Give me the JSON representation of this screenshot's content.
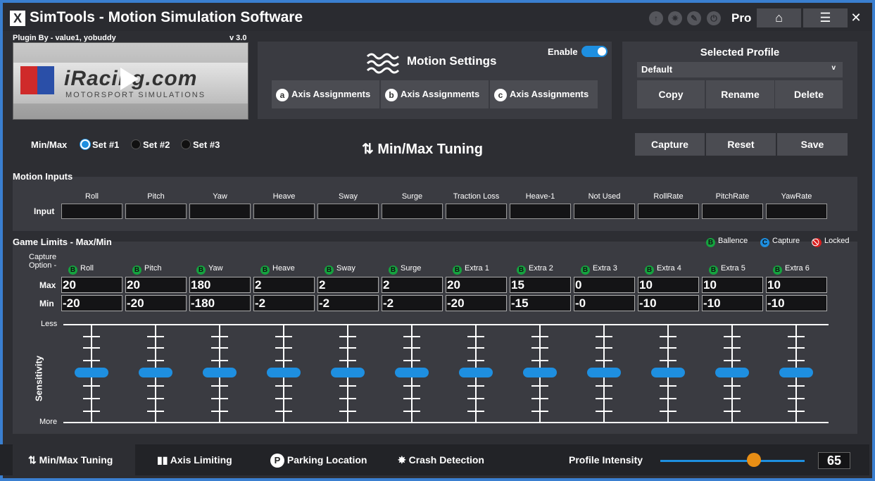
{
  "app": {
    "logo": "X",
    "title": "SimTools - Motion Simulation Software",
    "tier": "Pro"
  },
  "titlebar_icons": [
    "arrow-up-icon",
    "sparkle-icon",
    "wrench-icon",
    "power-icon"
  ],
  "plugin": {
    "by": "Plugin By - value1, yobuddy",
    "version": "v 3.0",
    "game_name": "iRacing.com",
    "game_sub": "MOTORSPORT SIMULATIONS"
  },
  "motion_settings": {
    "title": "Motion Settings",
    "enable_label": "Enable",
    "enabled": true,
    "axis_buttons": [
      {
        "letter": "a",
        "label": "Axis Assignments"
      },
      {
        "letter": "b",
        "label": "Axis Assignments"
      },
      {
        "letter": "c",
        "label": "Axis Assignments"
      }
    ]
  },
  "profile": {
    "title": "Selected Profile",
    "selected": "Default",
    "chevron": "v",
    "buttons": [
      "Copy",
      "Rename",
      "Delete"
    ]
  },
  "tuning": {
    "minmax_label": "Min/Max",
    "sets": [
      "Set #1",
      "Set #2",
      "Set #3"
    ],
    "selected_set": 0,
    "title": "Min/Max Tuning",
    "buttons": [
      "Capture",
      "Reset",
      "Save"
    ]
  },
  "motion_inputs": {
    "title": "Motion Inputs",
    "row_label": "Input",
    "columns": [
      "Roll",
      "Pitch",
      "Yaw",
      "Heave",
      "Sway",
      "Surge",
      "Traction Loss",
      "Heave-1",
      "Not Used",
      "RollRate",
      "PitchRate",
      "YawRate"
    ]
  },
  "game_limits": {
    "title": "Game Limits - Max/Min",
    "legend": [
      {
        "letter": "B",
        "label": "Ballence",
        "color": "#15a33f"
      },
      {
        "letter": "C",
        "label": "Capture",
        "color": "#1e8fe0"
      },
      {
        "letter": "",
        "label": "Locked",
        "color": "#d81f1f"
      }
    ],
    "capture_option_label": "Capture Option -",
    "max_label": "Max",
    "min_label": "Min",
    "axes": [
      {
        "name": "Roll",
        "max": "20",
        "min": "-20"
      },
      {
        "name": "Pitch",
        "max": "20",
        "min": "-20"
      },
      {
        "name": "Yaw",
        "max": "180",
        "min": "-180"
      },
      {
        "name": "Heave",
        "max": "2",
        "min": "-2"
      },
      {
        "name": "Sway",
        "max": "2",
        "min": "-2"
      },
      {
        "name": "Surge",
        "max": "2",
        "min": "-2"
      },
      {
        "name": "Extra 1",
        "max": "20",
        "min": "-20"
      },
      {
        "name": "Extra 2",
        "max": "15",
        "min": "-15"
      },
      {
        "name": "Extra 3",
        "max": "0",
        "min": "-0"
      },
      {
        "name": "Extra 4",
        "max": "10",
        "min": "-10"
      },
      {
        "name": "Extra 5",
        "max": "10",
        "min": "-10"
      },
      {
        "name": "Extra 6",
        "max": "10",
        "min": "-10"
      }
    ],
    "sensitivity_label": "Sensitivity",
    "less_label": "Less",
    "more_label": "More"
  },
  "bottom_tabs": [
    {
      "label": "Min/Max Tuning",
      "icon": "updown-arrows-icon"
    },
    {
      "label": "Axis Limiting",
      "icon": "bars-icon"
    },
    {
      "label": "Parking Location",
      "icon": "parking-icon"
    },
    {
      "label": "Crash Detection",
      "icon": "crash-icon"
    }
  ],
  "intensity": {
    "label": "Profile Intensity",
    "value": "65",
    "fraction": 0.65
  }
}
